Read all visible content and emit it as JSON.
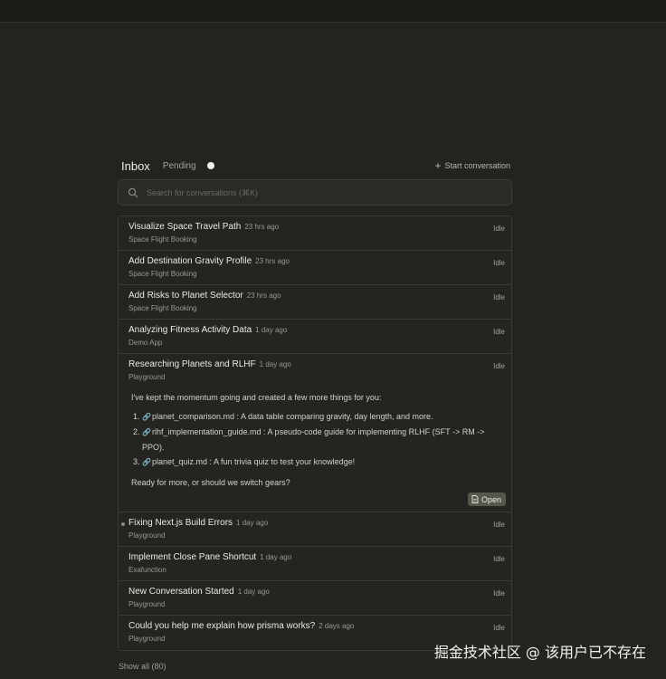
{
  "header": {
    "title": "Inbox",
    "pending_label": "Pending",
    "start_conversation": "Start conversation"
  },
  "search": {
    "placeholder": "Search for conversations (⌘K)"
  },
  "conversations": [
    {
      "title": "Visualize Space Travel Path",
      "time": "23 hrs ago",
      "project": "Space Flight Booking",
      "status": "Idle"
    },
    {
      "title": "Add Destination Gravity Profile",
      "time": "23 hrs ago",
      "project": "Space Flight Booking",
      "status": "Idle"
    },
    {
      "title": "Add Risks to Planet Selector",
      "time": "23 hrs ago",
      "project": "Space Flight Booking",
      "status": "Idle"
    },
    {
      "title": "Analyzing Fitness Activity Data",
      "time": "1 day ago",
      "project": "Demo App",
      "status": "Idle"
    },
    {
      "title": "Researching Planets and RLHF",
      "time": "1 day ago",
      "project": "Playground",
      "status": "Idle",
      "message_intro": "I've kept the momentum going and created a few more things for you:",
      "items": [
        {
          "file": "planet_comparison.md",
          "desc": " : A data table comparing gravity, day length, and more."
        },
        {
          "file": "rlhf_implementation_guide.md",
          "desc": " : A pseudo-code guide for implementing RLHF (SFT -> RM -> PPO)."
        },
        {
          "file": "planet_quiz.md",
          "desc": " : A fun trivia quiz to test your knowledge!"
        }
      ],
      "message_outro": "Ready for more, or should we switch gears?",
      "open_label": "Open"
    },
    {
      "title": "Fixing Next.js Build Errors",
      "time": "1 day ago",
      "project": "Playground",
      "status": "Idle"
    },
    {
      "title": "Implement Close Pane Shortcut",
      "time": "1 day ago",
      "project": "Exafunction",
      "status": "Idle"
    },
    {
      "title": "New Conversation Started",
      "time": "1 day ago",
      "project": "Playground",
      "status": "Idle"
    },
    {
      "title": "Could you help me explain how prisma works?",
      "time": "2 days ago",
      "project": "Playground",
      "status": "Idle"
    }
  ],
  "footer": {
    "show_all": "Show all (80)"
  },
  "watermark": "掘金技术社区 @ 该用户已不存在",
  "icons": {
    "search": "search-icon",
    "plus": "plus-icon",
    "file_link": "link-icon",
    "open": "document-icon"
  },
  "colors": {
    "background": "#23231f",
    "panel_border": "#3a3a34",
    "open_button": "#56574b",
    "text_primary": "#eceae2",
    "text_muted": "#9a988f"
  }
}
